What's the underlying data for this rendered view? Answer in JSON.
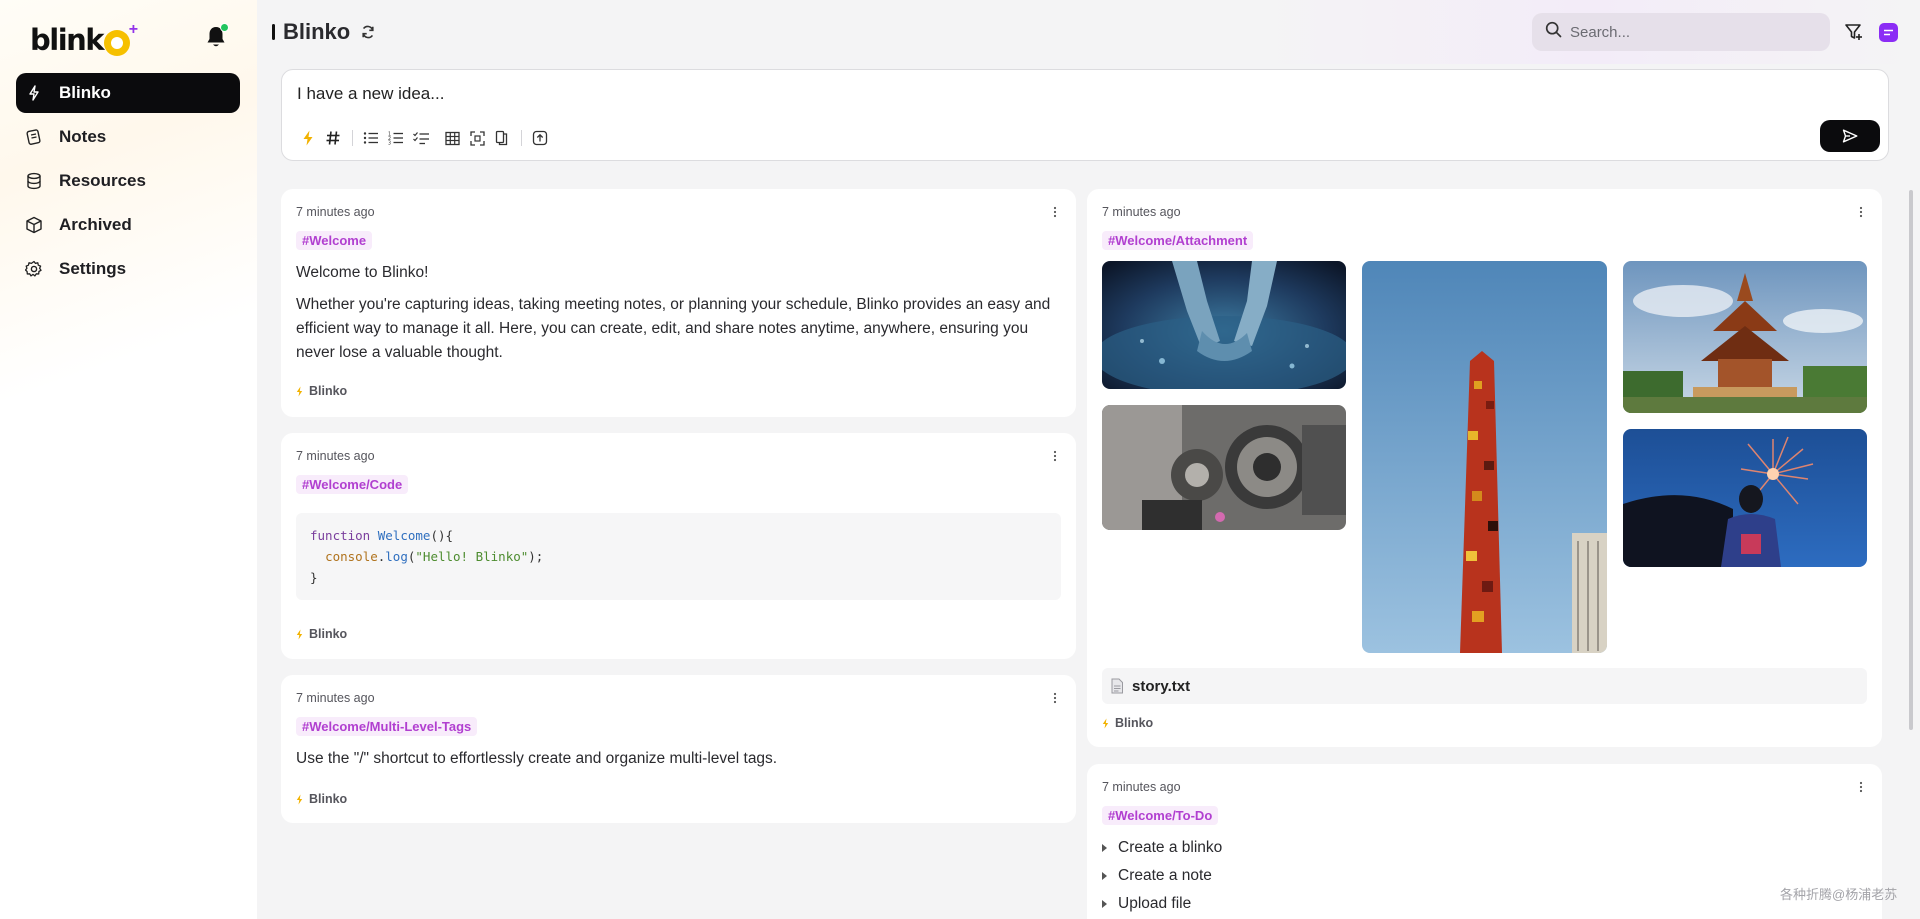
{
  "app": {
    "brand": "blinko",
    "page_title": "Blinko"
  },
  "sidebar": {
    "items": [
      {
        "label": "Blinko",
        "icon": "bolt-icon",
        "active": true
      },
      {
        "label": "Notes",
        "icon": "notes-icon",
        "active": false
      },
      {
        "label": "Resources",
        "icon": "database-icon",
        "active": false
      },
      {
        "label": "Archived",
        "icon": "archive-box-icon",
        "active": false
      },
      {
        "label": "Settings",
        "icon": "gear-icon",
        "active": false
      }
    ]
  },
  "header": {
    "search_placeholder": "Search..."
  },
  "editor": {
    "placeholder": "I have a new idea..."
  },
  "cards": {
    "welcome": {
      "time": "7 minutes ago",
      "tag": "#Welcome",
      "title": "Welcome to Blinko!",
      "body": "Whether you're capturing ideas, taking meeting notes, or planning your schedule, Blinko provides an easy and efficient way to manage it all. Here, you can create, edit, and share notes anytime, anywhere, ensuring you never lose a valuable thought.",
      "source": "Blinko"
    },
    "code": {
      "time": "7 minutes ago",
      "tag": "#Welcome/Code",
      "line1_kw": "function",
      "line1_fn": "Welcome",
      "line1_rest": "(){",
      "line2_obj": "console",
      "line2_dot": ".",
      "line2_fn": "log",
      "line2_open": "(",
      "line2_str": "\"Hello! Blinko\"",
      "line2_close": ");",
      "line3": "}",
      "source": "Blinko"
    },
    "tags": {
      "time": "7 minutes ago",
      "tag": "#Welcome/Multi-Level-Tags",
      "body": "Use the \"/\" shortcut to effortlessly create and organize multi-level tags.",
      "source": "Blinko"
    },
    "attachment": {
      "time": "7 minutes ago",
      "tag": "#Welcome/Attachment",
      "file": "story.txt",
      "source": "Blinko"
    },
    "todo": {
      "time": "7 minutes ago",
      "tag": "#Welcome/To-Do",
      "items": [
        "Create a blinko",
        "Create a note",
        "Upload file"
      ]
    }
  },
  "watermark": "各种折腾@杨浦老苏",
  "colors": {
    "accent": "#0b0b0d",
    "tag_bg": "#f8ecfb",
    "tag_text": "#b13fd0",
    "brand_yellow": "#f6c000",
    "ai_purple": "#8b2cf5"
  }
}
